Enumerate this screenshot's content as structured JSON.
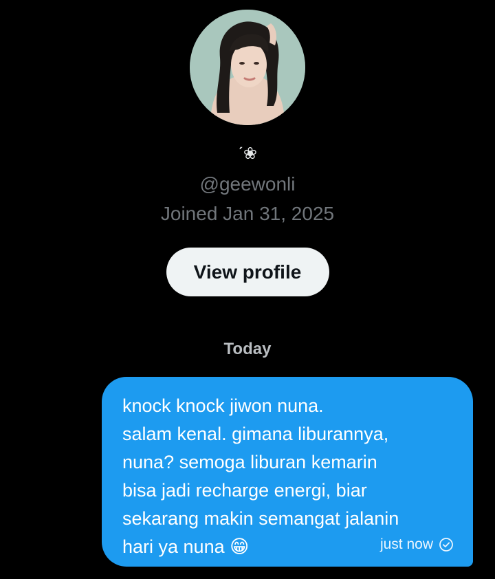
{
  "profile": {
    "display_name": "ˊ❀",
    "handle": "@geewonli",
    "joined": "Joined Jan 31, 2025",
    "view_profile_label": "View profile"
  },
  "conversation": {
    "date_divider": "Today",
    "messages": [
      {
        "text": "knock knock jiwon nuna.\nsalam kenal. gimana liburannya,\nnuna? semoga liburan kemarin\nbisa jadi recharge energi, biar\nsekarang makin semangat jalanin\nhari ya nuna 😁",
        "time": "just now",
        "status_icon": "check-circle-icon",
        "sent_by_me": true
      }
    ]
  },
  "colors": {
    "background": "#000000",
    "bubble": "#1d9bf0",
    "muted_text": "#71767b",
    "button_bg": "#eff3f4"
  }
}
